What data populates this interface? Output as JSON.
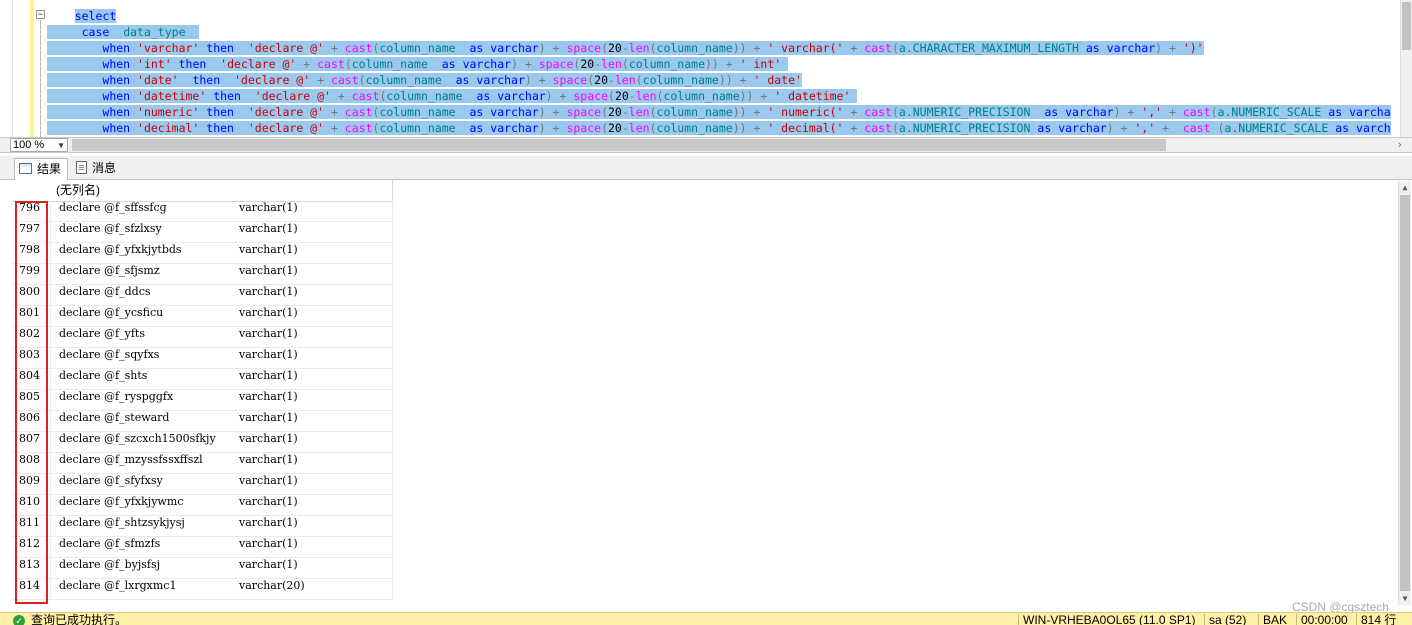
{
  "editor": {
    "lines": [
      [
        {
          "t": "    "
        },
        {
          "t": "select",
          "c": "kw",
          "s": true
        }
      ],
      [
        {
          "t": "     ",
          "s": true
        },
        {
          "t": "case",
          "c": "kw",
          "s": true
        },
        {
          "t": "  ",
          "s": true
        },
        {
          "t": "data_type",
          "c": "id",
          "s": true
        },
        {
          "t": "  ",
          "s": true
        }
      ],
      [
        {
          "t": "        ",
          "s": true
        },
        {
          "t": "when",
          "c": "kw",
          "s": true
        },
        {
          "t": " ",
          "s": true
        },
        {
          "t": "'varchar'",
          "c": "str",
          "s": true
        },
        {
          "t": " ",
          "s": true
        },
        {
          "t": "then",
          "c": "kw",
          "s": true
        },
        {
          "t": "  ",
          "s": true
        },
        {
          "t": "'declare @'",
          "c": "str",
          "s": true
        },
        {
          "t": " + ",
          "c": "op",
          "s": true
        },
        {
          "t": "cast",
          "c": "fn",
          "s": true
        },
        {
          "t": "(",
          "c": "op",
          "s": true
        },
        {
          "t": "column_name",
          "c": "id",
          "s": true
        },
        {
          "t": "  ",
          "s": true
        },
        {
          "t": "as",
          "c": "kw",
          "s": true
        },
        {
          "t": " ",
          "s": true
        },
        {
          "t": "varchar",
          "c": "kw",
          "s": true
        },
        {
          "t": ") + ",
          "c": "op",
          "s": true
        },
        {
          "t": "space",
          "c": "fn",
          "s": true
        },
        {
          "t": "(",
          "c": "op",
          "s": true
        },
        {
          "t": "20",
          "c": "num",
          "s": true
        },
        {
          "t": "-",
          "c": "op",
          "s": true
        },
        {
          "t": "len",
          "c": "fn",
          "s": true
        },
        {
          "t": "(",
          "c": "op",
          "s": true
        },
        {
          "t": "column_name",
          "c": "id",
          "s": true
        },
        {
          "t": ")) + ",
          "c": "op",
          "s": true
        },
        {
          "t": "' varchar('",
          "c": "str",
          "s": true
        },
        {
          "t": " + ",
          "c": "op",
          "s": true
        },
        {
          "t": "cast",
          "c": "fn",
          "s": true
        },
        {
          "t": "(",
          "c": "op",
          "s": true
        },
        {
          "t": "a.CHARACTER_MAXIMUM_LENGTH",
          "c": "id",
          "s": true
        },
        {
          "t": " ",
          "s": true
        },
        {
          "t": "as",
          "c": "kw",
          "s": true
        },
        {
          "t": " ",
          "s": true
        },
        {
          "t": "varchar",
          "c": "kw",
          "s": true
        },
        {
          "t": ") + ",
          "c": "op",
          "s": true
        },
        {
          "t": "')'",
          "c": "str",
          "s": true
        }
      ],
      [
        {
          "t": "        ",
          "s": true
        },
        {
          "t": "when",
          "c": "kw",
          "s": true
        },
        {
          "t": " ",
          "s": true
        },
        {
          "t": "'int'",
          "c": "str",
          "s": true
        },
        {
          "t": " ",
          "s": true
        },
        {
          "t": "then",
          "c": "kw",
          "s": true
        },
        {
          "t": "  ",
          "s": true
        },
        {
          "t": "'declare @'",
          "c": "str",
          "s": true
        },
        {
          "t": " + ",
          "c": "op",
          "s": true
        },
        {
          "t": "cast",
          "c": "fn",
          "s": true
        },
        {
          "t": "(",
          "c": "op",
          "s": true
        },
        {
          "t": "column_name",
          "c": "id",
          "s": true
        },
        {
          "t": "  ",
          "s": true
        },
        {
          "t": "as",
          "c": "kw",
          "s": true
        },
        {
          "t": " ",
          "s": true
        },
        {
          "t": "varchar",
          "c": "kw",
          "s": true
        },
        {
          "t": ") + ",
          "c": "op",
          "s": true
        },
        {
          "t": "space",
          "c": "fn",
          "s": true
        },
        {
          "t": "(",
          "c": "op",
          "s": true
        },
        {
          "t": "20",
          "c": "num",
          "s": true
        },
        {
          "t": "-",
          "c": "op",
          "s": true
        },
        {
          "t": "len",
          "c": "fn",
          "s": true
        },
        {
          "t": "(",
          "c": "op",
          "s": true
        },
        {
          "t": "column_name",
          "c": "id",
          "s": true
        },
        {
          "t": ")) + ",
          "c": "op",
          "s": true
        },
        {
          "t": "' int'",
          "c": "str",
          "s": true
        },
        {
          "t": " ",
          "s": true
        }
      ],
      [
        {
          "t": "        ",
          "s": true
        },
        {
          "t": "when",
          "c": "kw",
          "s": true
        },
        {
          "t": " ",
          "s": true
        },
        {
          "t": "'date'",
          "c": "str",
          "s": true
        },
        {
          "t": "  ",
          "s": true
        },
        {
          "t": "then",
          "c": "kw",
          "s": true
        },
        {
          "t": "  ",
          "s": true
        },
        {
          "t": "'declare @'",
          "c": "str",
          "s": true
        },
        {
          "t": " + ",
          "c": "op",
          "s": true
        },
        {
          "t": "cast",
          "c": "fn",
          "s": true
        },
        {
          "t": "(",
          "c": "op",
          "s": true
        },
        {
          "t": "column_name",
          "c": "id",
          "s": true
        },
        {
          "t": "  ",
          "s": true
        },
        {
          "t": "as",
          "c": "kw",
          "s": true
        },
        {
          "t": " ",
          "s": true
        },
        {
          "t": "varchar",
          "c": "kw",
          "s": true
        },
        {
          "t": ") + ",
          "c": "op",
          "s": true
        },
        {
          "t": "space",
          "c": "fn",
          "s": true
        },
        {
          "t": "(",
          "c": "op",
          "s": true
        },
        {
          "t": "20",
          "c": "num",
          "s": true
        },
        {
          "t": "-",
          "c": "op",
          "s": true
        },
        {
          "t": "len",
          "c": "fn",
          "s": true
        },
        {
          "t": "(",
          "c": "op",
          "s": true
        },
        {
          "t": "column_name",
          "c": "id",
          "s": true
        },
        {
          "t": ")) + ",
          "c": "op",
          "s": true
        },
        {
          "t": "' date'",
          "c": "str",
          "s": true
        }
      ],
      [
        {
          "t": "        ",
          "s": true
        },
        {
          "t": "when",
          "c": "kw",
          "s": true
        },
        {
          "t": " ",
          "s": true
        },
        {
          "t": "'datetime'",
          "c": "str",
          "s": true
        },
        {
          "t": " ",
          "s": true
        },
        {
          "t": "then",
          "c": "kw",
          "s": true
        },
        {
          "t": "  ",
          "s": true
        },
        {
          "t": "'declare @'",
          "c": "str",
          "s": true
        },
        {
          "t": " + ",
          "c": "op",
          "s": true
        },
        {
          "t": "cast",
          "c": "fn",
          "s": true
        },
        {
          "t": "(",
          "c": "op",
          "s": true
        },
        {
          "t": "column_name",
          "c": "id",
          "s": true
        },
        {
          "t": "  ",
          "s": true
        },
        {
          "t": "as",
          "c": "kw",
          "s": true
        },
        {
          "t": " ",
          "s": true
        },
        {
          "t": "varchar",
          "c": "kw",
          "s": true
        },
        {
          "t": ") + ",
          "c": "op",
          "s": true
        },
        {
          "t": "space",
          "c": "fn",
          "s": true
        },
        {
          "t": "(",
          "c": "op",
          "s": true
        },
        {
          "t": "20",
          "c": "num",
          "s": true
        },
        {
          "t": "-",
          "c": "op",
          "s": true
        },
        {
          "t": "len",
          "c": "fn",
          "s": true
        },
        {
          "t": "(",
          "c": "op",
          "s": true
        },
        {
          "t": "column_name",
          "c": "id",
          "s": true
        },
        {
          "t": ")) + ",
          "c": "op",
          "s": true
        },
        {
          "t": "' datetime'",
          "c": "str",
          "s": true
        },
        {
          "t": " ",
          "s": true
        }
      ],
      [
        {
          "t": "        ",
          "s": true
        },
        {
          "t": "when",
          "c": "kw",
          "s": true
        },
        {
          "t": " ",
          "s": true
        },
        {
          "t": "'numeric'",
          "c": "str",
          "s": true
        },
        {
          "t": " ",
          "s": true
        },
        {
          "t": "then",
          "c": "kw",
          "s": true
        },
        {
          "t": "  ",
          "s": true
        },
        {
          "t": "'declare @'",
          "c": "str",
          "s": true
        },
        {
          "t": " + ",
          "c": "op",
          "s": true
        },
        {
          "t": "cast",
          "c": "fn",
          "s": true
        },
        {
          "t": "(",
          "c": "op",
          "s": true
        },
        {
          "t": "column_name",
          "c": "id",
          "s": true
        },
        {
          "t": "  ",
          "s": true
        },
        {
          "t": "as",
          "c": "kw",
          "s": true
        },
        {
          "t": " ",
          "s": true
        },
        {
          "t": "varchar",
          "c": "kw",
          "s": true
        },
        {
          "t": ") + ",
          "c": "op",
          "s": true
        },
        {
          "t": "space",
          "c": "fn",
          "s": true
        },
        {
          "t": "(",
          "c": "op",
          "s": true
        },
        {
          "t": "20",
          "c": "num",
          "s": true
        },
        {
          "t": "-",
          "c": "op",
          "s": true
        },
        {
          "t": "len",
          "c": "fn",
          "s": true
        },
        {
          "t": "(",
          "c": "op",
          "s": true
        },
        {
          "t": "column_name",
          "c": "id",
          "s": true
        },
        {
          "t": ")) + ",
          "c": "op",
          "s": true
        },
        {
          "t": "' numeric('",
          "c": "str",
          "s": true
        },
        {
          "t": " + ",
          "c": "op",
          "s": true
        },
        {
          "t": "cast",
          "c": "fn",
          "s": true
        },
        {
          "t": "(",
          "c": "op",
          "s": true
        },
        {
          "t": "a.NUMERIC_PRECISION",
          "c": "id",
          "s": true
        },
        {
          "t": "  ",
          "s": true
        },
        {
          "t": "as",
          "c": "kw",
          "s": true
        },
        {
          "t": " ",
          "s": true
        },
        {
          "t": "varchar",
          "c": "kw",
          "s": true
        },
        {
          "t": ") + ",
          "c": "op",
          "s": true
        },
        {
          "t": "','",
          "c": "str",
          "s": true
        },
        {
          "t": " + ",
          "c": "op",
          "s": true
        },
        {
          "t": "cast",
          "c": "fn",
          "s": true
        },
        {
          "t": "(",
          "c": "op",
          "s": true
        },
        {
          "t": "a.NUMERIC_SCALE",
          "c": "id",
          "s": true
        },
        {
          "t": " ",
          "s": true
        },
        {
          "t": "as",
          "c": "kw",
          "s": true
        },
        {
          "t": " ",
          "s": true
        },
        {
          "t": "varcha",
          "c": "kw",
          "s": true
        }
      ],
      [
        {
          "t": "        ",
          "s": true
        },
        {
          "t": "when",
          "c": "kw",
          "s": true
        },
        {
          "t": " ",
          "s": true
        },
        {
          "t": "'decimal'",
          "c": "str",
          "s": true
        },
        {
          "t": " ",
          "s": true
        },
        {
          "t": "then",
          "c": "kw",
          "s": true
        },
        {
          "t": "  ",
          "s": true
        },
        {
          "t": "'declare @'",
          "c": "str",
          "s": true
        },
        {
          "t": " + ",
          "c": "op",
          "s": true
        },
        {
          "t": "cast",
          "c": "fn",
          "s": true
        },
        {
          "t": "(",
          "c": "op",
          "s": true
        },
        {
          "t": "column_name",
          "c": "id",
          "s": true
        },
        {
          "t": "  ",
          "s": true
        },
        {
          "t": "as",
          "c": "kw",
          "s": true
        },
        {
          "t": " ",
          "s": true
        },
        {
          "t": "varchar",
          "c": "kw",
          "s": true
        },
        {
          "t": ") + ",
          "c": "op",
          "s": true
        },
        {
          "t": "space",
          "c": "fn",
          "s": true
        },
        {
          "t": "(",
          "c": "op",
          "s": true
        },
        {
          "t": "20",
          "c": "num",
          "s": true
        },
        {
          "t": "-",
          "c": "op",
          "s": true
        },
        {
          "t": "len",
          "c": "fn",
          "s": true
        },
        {
          "t": "(",
          "c": "op",
          "s": true
        },
        {
          "t": "column_name",
          "c": "id",
          "s": true
        },
        {
          "t": ")) + ",
          "c": "op",
          "s": true
        },
        {
          "t": "' decimal('",
          "c": "str",
          "s": true
        },
        {
          "t": " + ",
          "c": "op",
          "s": true
        },
        {
          "t": "cast",
          "c": "fn",
          "s": true
        },
        {
          "t": "(",
          "c": "op",
          "s": true
        },
        {
          "t": "a.NUMERIC_PRECISION",
          "c": "id",
          "s": true
        },
        {
          "t": " ",
          "s": true
        },
        {
          "t": "as",
          "c": "kw",
          "s": true
        },
        {
          "t": " ",
          "s": true
        },
        {
          "t": "varchar",
          "c": "kw",
          "s": true
        },
        {
          "t": ") + ",
          "c": "op",
          "s": true
        },
        {
          "t": "','",
          "c": "str",
          "s": true
        },
        {
          "t": " +  ",
          "c": "op",
          "s": true
        },
        {
          "t": "cast",
          "c": "fn",
          "s": true
        },
        {
          "t": " (",
          "c": "op",
          "s": true
        },
        {
          "t": "a.NUMERIC_SCALE",
          "c": "id",
          "s": true
        },
        {
          "t": " ",
          "s": true
        },
        {
          "t": "as",
          "c": "kw",
          "s": true
        },
        {
          "t": " ",
          "s": true
        },
        {
          "t": "varch",
          "c": "kw",
          "s": true
        }
      ]
    ]
  },
  "zoom": {
    "value": "100 %",
    "arrow_icon": "chevron-down-icon"
  },
  "tabs": {
    "results_label": "结果",
    "messages_label": "消息",
    "results_icon": "grid-icon",
    "messages_icon": "message-icon"
  },
  "grid": {
    "column_header": "(无列名)",
    "rows": [
      {
        "n": "796",
        "name": "declare @f_sffssfcg",
        "type": "varchar(1)"
      },
      {
        "n": "797",
        "name": "declare @f_sfzlxsy",
        "type": "varchar(1)"
      },
      {
        "n": "798",
        "name": "declare @f_yfxkjytbds",
        "type": "varchar(1)"
      },
      {
        "n": "799",
        "name": "declare @f_sfjsmz",
        "type": "varchar(1)"
      },
      {
        "n": "800",
        "name": "declare @f_ddcs",
        "type": "varchar(1)"
      },
      {
        "n": "801",
        "name": "declare @f_ycsficu",
        "type": "varchar(1)"
      },
      {
        "n": "802",
        "name": "declare @f_yfts",
        "type": "varchar(1)"
      },
      {
        "n": "803",
        "name": "declare @f_sqyfxs",
        "type": "varchar(1)"
      },
      {
        "n": "804",
        "name": "declare @f_shts",
        "type": "varchar(1)"
      },
      {
        "n": "805",
        "name": "declare @f_ryspggfx",
        "type": "varchar(1)"
      },
      {
        "n": "806",
        "name": "declare @f_steward",
        "type": "varchar(1)"
      },
      {
        "n": "807",
        "name": "declare @f_szcxch1500sfkjy",
        "type": "varchar(1)"
      },
      {
        "n": "808",
        "name": "declare @f_mzyssfssxffszl",
        "type": "varchar(1)"
      },
      {
        "n": "809",
        "name": "declare @f_sfyfxsy",
        "type": "varchar(1)"
      },
      {
        "n": "810",
        "name": "declare @f_yfxkjywmc",
        "type": "varchar(1)"
      },
      {
        "n": "811",
        "name": "declare @f_shtzsykjysj",
        "type": "varchar(1)"
      },
      {
        "n": "812",
        "name": "declare @f_sfmzfs",
        "type": "varchar(1)"
      },
      {
        "n": "813",
        "name": "declare @f_byjsfsj",
        "type": "varchar(1)"
      },
      {
        "n": "814",
        "name": "declare @f_lxrgxmc1",
        "type": "varchar(20)"
      }
    ]
  },
  "status": {
    "message": "查询已成功执行。",
    "server": "WIN-VRHEBA0OL65 (11.0 SP1)",
    "user": "sa (52)",
    "database": "BAK",
    "elapsed": "00:00:00",
    "rows": "814 行",
    "ok_icon": "success-check-icon"
  },
  "watermark": "CSDN @cqsztech",
  "colors": {
    "selection": "#99c9ef",
    "keyword": "#0000ff",
    "string": "#cc0000",
    "function": "#ff00ff",
    "status_bar": "#fff0a8",
    "highlight_box": "#e02020"
  }
}
